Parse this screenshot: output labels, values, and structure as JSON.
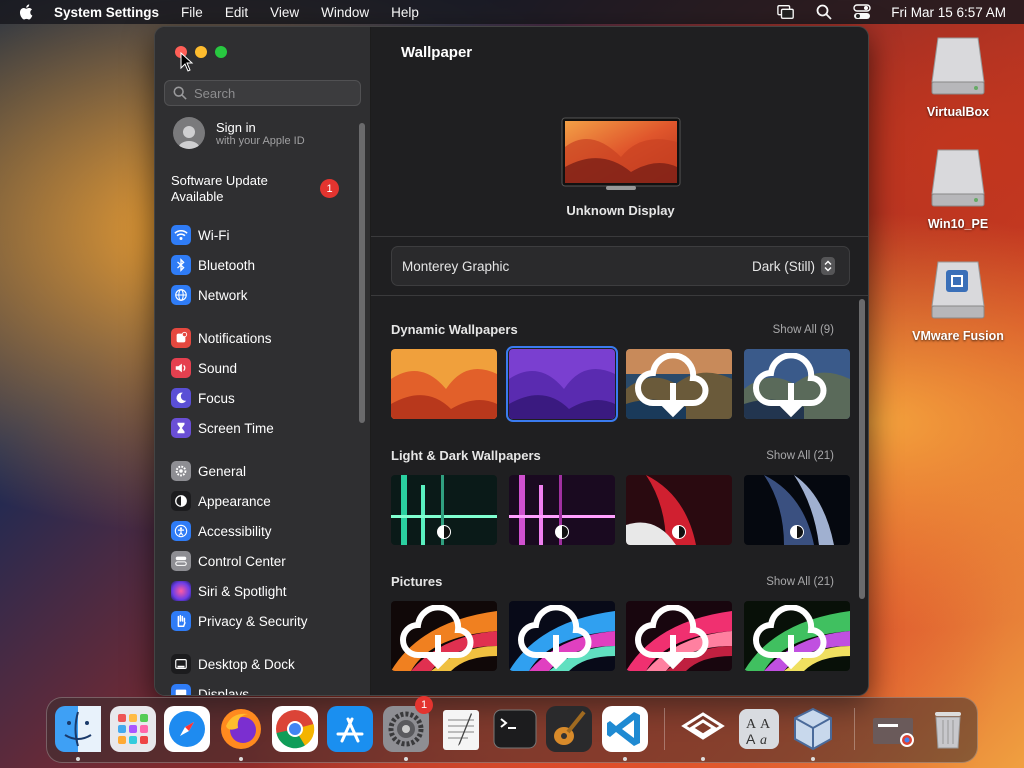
{
  "menubar": {
    "app_name": "System Settings",
    "menus": [
      "File",
      "Edit",
      "View",
      "Window",
      "Help"
    ],
    "datetime": "Fri Mar 15  6:57 AM"
  },
  "desktop_icons": [
    {
      "label": "VirtualBox"
    },
    {
      "label": "Win10_PE"
    },
    {
      "label": "VMware Fusion"
    }
  ],
  "sidebar": {
    "search_placeholder": "Search",
    "signin_title": "Sign in",
    "signin_subtitle": "with your Apple ID",
    "software_update": "Software Update Available",
    "software_update_badge": "1",
    "items": [
      {
        "label": "Wi-Fi",
        "icon": "wifi-icon",
        "color": "#2f7cf6"
      },
      {
        "label": "Bluetooth",
        "icon": "bluetooth-icon",
        "color": "#2f7cf6"
      },
      {
        "label": "Network",
        "icon": "globe-icon",
        "color": "#2f7cf6"
      },
      {
        "label": "Notifications",
        "icon": "bell-icon",
        "color": "#e5483f"
      },
      {
        "label": "Sound",
        "icon": "speaker-icon",
        "color": "#e5404f"
      },
      {
        "label": "Focus",
        "icon": "moon-icon",
        "color": "#5a4fd6"
      },
      {
        "label": "Screen Time",
        "icon": "hourglass-icon",
        "color": "#6a4fd6"
      },
      {
        "label": "General",
        "icon": "gear-icon",
        "color": "#8e8e93"
      },
      {
        "label": "Appearance",
        "icon": "appearance-icon",
        "color": "#1c1c1e"
      },
      {
        "label": "Accessibility",
        "icon": "accessibility-icon",
        "color": "#2f7cf6"
      },
      {
        "label": "Control Center",
        "icon": "control-center-icon",
        "color": "#8e8e93"
      },
      {
        "label": "Siri & Spotlight",
        "icon": "siri-icon",
        "color": "#b03ac8"
      },
      {
        "label": "Privacy & Security",
        "icon": "hand-icon",
        "color": "#2f7cf6"
      },
      {
        "label": "Desktop & Dock",
        "icon": "dock-icon",
        "color": "#1c1c1e"
      },
      {
        "label": "Displays",
        "icon": "display-icon",
        "color": "#2f7cf6"
      }
    ]
  },
  "main": {
    "title": "Wallpaper",
    "display_name": "Unknown Display",
    "current_wallpaper": "Monterey Graphic",
    "appearance_mode": "Dark (Still)",
    "sections": [
      {
        "title": "Dynamic Wallpapers",
        "show_all": "Show All (9)"
      },
      {
        "title": "Light & Dark Wallpapers",
        "show_all": "Show All (21)"
      },
      {
        "title": "Pictures",
        "show_all": "Show All (21)"
      }
    ]
  },
  "dock": {
    "apps": [
      "Finder",
      "Launchpad",
      "Safari",
      "Firefox",
      "Chrome",
      "App Store",
      "System Settings",
      "TextEdit",
      "Terminal",
      "GarageBand",
      "Visual Studio Code",
      "VMware",
      "Font Book",
      "VirtualBox",
      "Downloads",
      "Trash"
    ],
    "system_settings_badge": "1"
  }
}
